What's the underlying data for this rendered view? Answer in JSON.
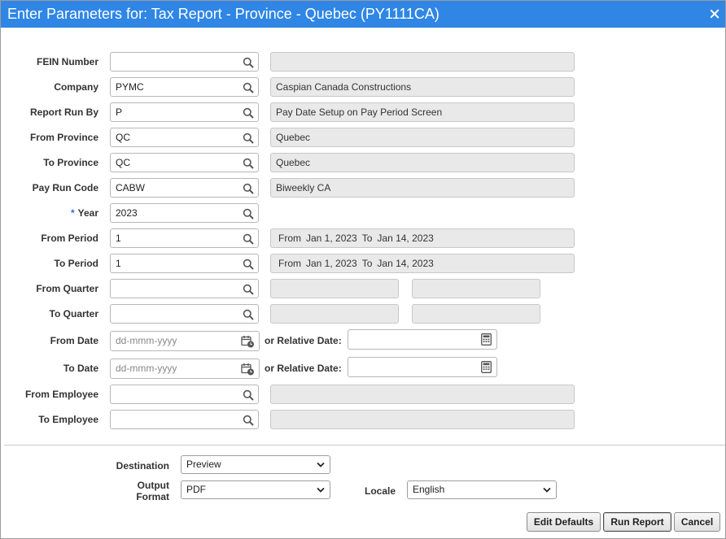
{
  "title": "Enter Parameters for: Tax Report - Province - Quebec (PY1111CA)",
  "fields": [
    {
      "key": "fein",
      "label": "FEIN Number",
      "value": "",
      "description": "",
      "required": false
    },
    {
      "key": "company",
      "label": "Company",
      "value": "PYMC",
      "description": "Caspian Canada Constructions",
      "required": false
    },
    {
      "key": "report-run-by",
      "label": "Report Run By",
      "value": "P",
      "description": "Pay Date Setup on Pay Period Screen",
      "required": false
    },
    {
      "key": "from-province",
      "label": "From Province",
      "value": "QC",
      "description": "Quebec",
      "required": false
    },
    {
      "key": "to-province",
      "label": "To Province",
      "value": "QC",
      "description": "Quebec",
      "required": false
    },
    {
      "key": "pay-run-code",
      "label": "Pay Run Code",
      "value": "CABW",
      "description": "Biweekly CA",
      "required": false
    },
    {
      "key": "year",
      "label": "Year",
      "value": "2023",
      "required": true,
      "required_mark": "*"
    },
    {
      "key": "from-period",
      "label": "From Period",
      "value": "1",
      "period": {
        "from_label": "From",
        "from": "Jan 1, 2023",
        "to_label": "To",
        "to": "Jan 14, 2023"
      }
    },
    {
      "key": "to-period",
      "label": "To Period",
      "value": "1",
      "period": {
        "from_label": "From",
        "from": "Jan 1, 2023",
        "to_label": "To",
        "to": "Jan 14, 2023"
      }
    },
    {
      "key": "from-quarter",
      "label": "From Quarter",
      "value": ""
    },
    {
      "key": "to-quarter",
      "label": "To Quarter",
      "value": ""
    }
  ],
  "dates": [
    {
      "key": "from-date",
      "label": "From Date",
      "placeholder": "dd-mmm-yyyy",
      "relative_label": "or Relative Date:",
      "relative_value": ""
    },
    {
      "key": "to-date",
      "label": "To Date",
      "placeholder": "dd-mmm-yyyy",
      "relative_label": "or Relative Date:",
      "relative_value": ""
    }
  ],
  "employees": [
    {
      "key": "from-employee",
      "label": "From Employee",
      "value": "",
      "description": ""
    },
    {
      "key": "to-employee",
      "label": "To Employee",
      "value": "",
      "description": ""
    }
  ],
  "output": {
    "destination_label": "Destination",
    "destination_value": "Preview",
    "format_label_line1": "Output",
    "format_label_line2": "Format",
    "format_value": "PDF",
    "locale_label": "Locale",
    "locale_value": "English"
  },
  "buttons": {
    "edit_defaults": "Edit Defaults",
    "run_report": "Run Report",
    "cancel": "Cancel"
  },
  "colors": {
    "title_bar": "#2f86e5",
    "required_mark": "#2f6fd6",
    "readonly_bg": "#e9e9e9"
  },
  "icons": {
    "lookup": "search-icon",
    "date": "calendar-icon",
    "relative": "calculator-icon",
    "close": "close-icon",
    "dropdown": "chevron-down-icon"
  }
}
